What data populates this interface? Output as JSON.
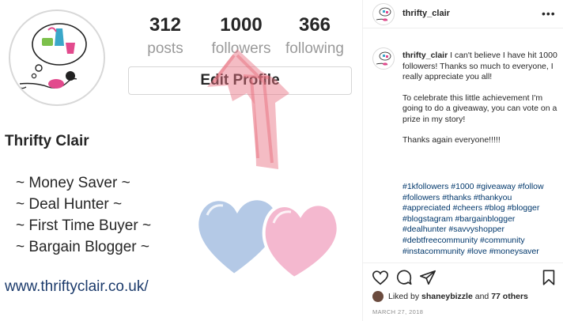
{
  "image": {
    "stats": [
      {
        "value": "312",
        "label": "posts"
      },
      {
        "value": "1000",
        "label": "followers"
      },
      {
        "value": "366",
        "label": "following"
      }
    ],
    "edit_profile_label": "Edit Profile",
    "profile_name": "Thrifty Clair",
    "bio_lines": [
      "~ Money Saver ~",
      "~ Deal Hunter ~",
      "~ First Time Buyer ~",
      "~ Bargain Blogger ~"
    ],
    "website": "www.thriftyclair.co.uk/"
  },
  "post": {
    "username": "thrifty_clair",
    "more_icon": "more-horizontal-icon",
    "caption_paragraphs": [
      "I can't believe I have hit 1000 followers! Thanks so much to everyone, I really appreciate you all!",
      "To celebrate this little achievement I'm going to do a giveaway, you can vote on a prize in my story!",
      "Thanks again everyone!!!!!"
    ],
    "hashtags": "#1kfollowers #1000 #giveaway #follow #followers #thanks #thankyou #appreciated #cheers #blog #blogger #blogstagram #bargainblogger #dealhunter #savvyshopper #debtfreecommunity #community #instacommunity #love #moneysaver",
    "actions": [
      "heart-icon",
      "comment-icon",
      "share-icon",
      "bookmark-icon"
    ],
    "liked_prefix": "Liked by",
    "liked_user": "shaneybizzle",
    "liked_and": "and",
    "liked_others": "77 others",
    "date": "MARCH 27, 2018"
  },
  "colors": {
    "hashtag": "#00376b",
    "heart_pink": "#f4b8cf",
    "heart_blue": "#b4c9e6",
    "arrow": "#e8707f"
  }
}
